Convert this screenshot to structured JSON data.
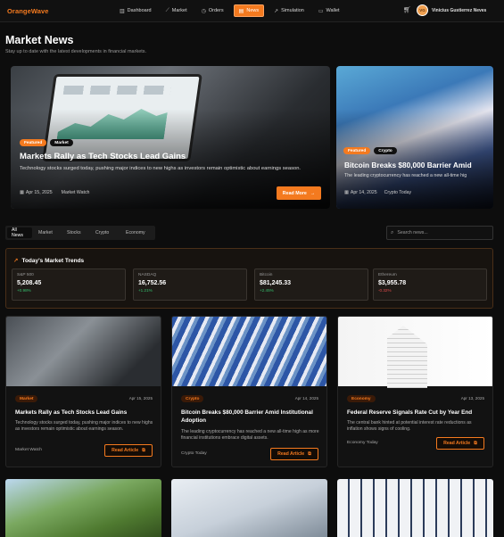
{
  "nav": {
    "brand": "OrangeWave",
    "items": [
      {
        "label": "Dashboard",
        "icon": "chart-bars-icon"
      },
      {
        "label": "Market",
        "icon": "line-chart-icon"
      },
      {
        "label": "Orders",
        "icon": "clock-icon"
      },
      {
        "label": "News",
        "icon": "newspaper-icon",
        "active": true
      },
      {
        "label": "Simulation",
        "icon": "trend-icon"
      },
      {
        "label": "Wallet",
        "icon": "wallet-icon"
      }
    ],
    "user": {
      "name": "Vinicius Gustierrez Neves",
      "initials": "VG"
    }
  },
  "header": {
    "title": "Market News",
    "subtitle": "Stay up to date with the latest developments in financial markets."
  },
  "featured": [
    {
      "tag": "Featured",
      "category": "Market",
      "title": "Markets Rally as Tech Stocks Lead Gains",
      "description": "Technology stocks surged today, pushing major indices to new highs as investors remain optimistic about earnings season.",
      "date": "Apr 15, 2025",
      "source": "Market Watch",
      "button": "Read More"
    },
    {
      "tag": "Featured",
      "category": "Crypto",
      "title": "Bitcoin Breaks $80,000 Barrier Amid",
      "description": "The leading cryptocurrency has reached a new all-time hig",
      "date": "Apr 14, 2025",
      "source": "Crypto Today"
    }
  ],
  "filters": {
    "tabs": [
      "All News",
      "Market",
      "Stocks",
      "Crypto",
      "Economy"
    ],
    "search_placeholder": "Search news..."
  },
  "trends": {
    "title": "Today's Market Trends",
    "items": [
      {
        "name": "S&P 500",
        "value": "5,208.45",
        "change": "+0.98%",
        "direction": "up"
      },
      {
        "name": "NASDAQ",
        "value": "16,752.56",
        "change": "+1.21%",
        "direction": "up"
      },
      {
        "name": "Bitcoin",
        "value": "$81,245.33",
        "change": "+2.45%",
        "direction": "up"
      },
      {
        "name": "Ethereum",
        "value": "$3,955.78",
        "change": "-0.32%",
        "direction": "down"
      }
    ]
  },
  "articles": [
    {
      "category": "Market",
      "date": "Apr 15, 2025",
      "title": "Markets Rally as Tech Stocks Lead Gains",
      "description": "Technology stocks surged today, pushing major indices to new highs as investors remain optimistic about earnings season.",
      "source": "Market Watch",
      "button": "Read Article"
    },
    {
      "category": "Crypto",
      "date": "Apr 14, 2025",
      "title": "Bitcoin Breaks $80,000 Barrier Amid Institutional Adoption",
      "description": "The leading cryptocurrency has reached a new all-time high as more financial institutions embrace digital assets.",
      "source": "Crypto Today",
      "button": "Read Article"
    },
    {
      "category": "Economy",
      "date": "Apr 13, 2025",
      "title": "Federal Reserve Signals Rate Cut by Year End",
      "description": "The central bank hinted at potential interest rate reductions as inflation shows signs of cooling.",
      "source": "Economy Today",
      "button": "Read Article"
    }
  ],
  "colors": {
    "accent": "#f47a1f",
    "positive": "#36c06e",
    "negative": "#e24b4b",
    "background": "#0d0d0d"
  }
}
